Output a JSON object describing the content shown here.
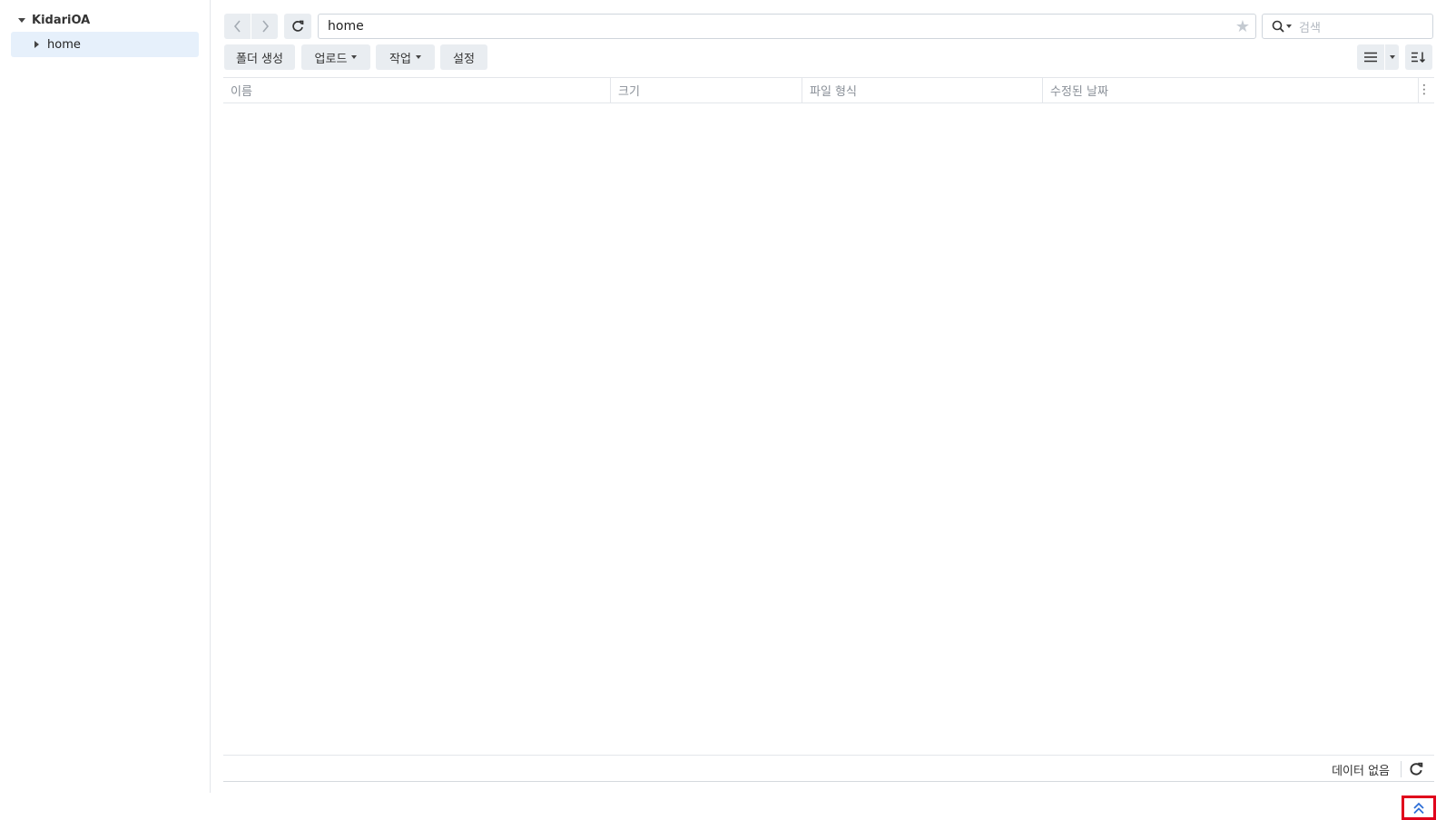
{
  "sidebar": {
    "root_label": "KidariOA",
    "items": [
      {
        "label": "home"
      }
    ]
  },
  "navbar": {
    "path": "home",
    "search_placeholder": "검색"
  },
  "toolbar": {
    "create_folder": "폴더 생성",
    "upload": "업로드",
    "action": "작업",
    "settings": "설정"
  },
  "table": {
    "columns": [
      "이름",
      "크기",
      "파일 형식",
      "수정된 날짜"
    ]
  },
  "footer": {
    "status": "데이터 없음"
  },
  "colors": {
    "selected_bg": "#e6f0fb",
    "button_bg": "#e9edf1",
    "highlight_box": "#e0001b",
    "scrolltop_icon": "#2f6fd6"
  }
}
